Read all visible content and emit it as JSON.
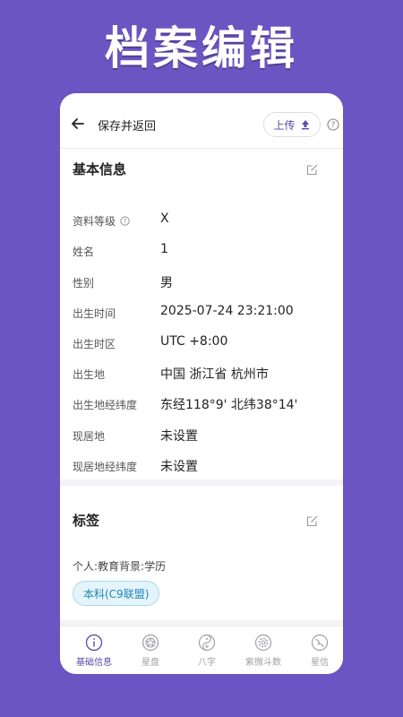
{
  "banner": {
    "title": "档案编辑"
  },
  "topbar": {
    "back_icon": "arrow-left-icon",
    "title": "保存并返回",
    "upload_label": "上传",
    "upload_icon": "upload-arrow-icon",
    "help_icon": "question-circle-icon"
  },
  "basic_info": {
    "title": "基本信息",
    "edit_icon": "edit-icon",
    "rows": [
      {
        "label": "资料等级",
        "value": "X",
        "has_help": true
      },
      {
        "label": "姓名",
        "value": "1"
      },
      {
        "label": "性别",
        "value": "男"
      },
      {
        "label": "出生时间",
        "value": "2025-07-24 23:21:00"
      },
      {
        "label": "出生时区",
        "value": "UTC +8:00"
      },
      {
        "label": "出生地",
        "value": "中国 浙江省 杭州市"
      },
      {
        "label": "出生地经纬度",
        "value": "东经118°9'  北纬38°14'"
      },
      {
        "label": "现居地",
        "value": "未设置"
      },
      {
        "label": "现居地经纬度",
        "value": "未设置"
      }
    ]
  },
  "tags": {
    "title": "标签",
    "edit_icon": "edit-icon",
    "category": "个人:教育背景:学历",
    "chip": "本科(C9联盟)"
  },
  "tabbar": {
    "items": [
      {
        "label": "基础信息",
        "icon": "info-circle-icon",
        "active": true
      },
      {
        "label": "星盘",
        "icon": "star-chart-icon"
      },
      {
        "label": "八字",
        "icon": "yin-yang-icon"
      },
      {
        "label": "紫微斗数",
        "icon": "gear-circle-icon"
      },
      {
        "label": "星信",
        "icon": "moon-circle-icon"
      }
    ]
  },
  "colors": {
    "background": "#6a55c2",
    "accent": "#5b4aa8",
    "chip_bg": "#e4f4fb",
    "chip_text": "#1d86b8"
  }
}
